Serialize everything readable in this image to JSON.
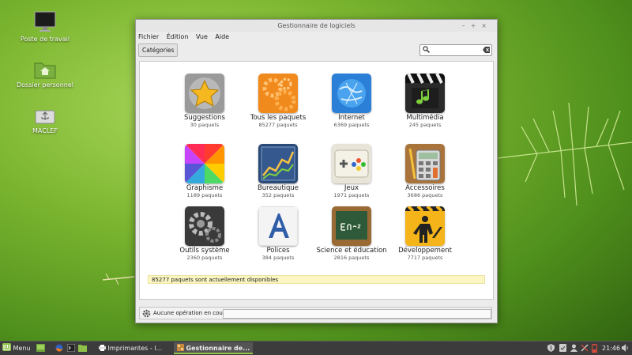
{
  "desktop": {
    "icons": [
      {
        "label": "Poste de travail",
        "icon": "computer-icon"
      },
      {
        "label": "Dossier personnel",
        "icon": "home-folder-icon"
      },
      {
        "label": "MACLEF",
        "icon": "usb-drive-icon"
      }
    ]
  },
  "window": {
    "title": "Gestionnaire de logiciels",
    "controls": [
      "–",
      "+",
      "×"
    ],
    "menu": [
      "Fichier",
      "Édition",
      "Vue",
      "Aide"
    ],
    "toolbar": {
      "categories_label": "Catégories",
      "search_value": ""
    },
    "categories": [
      {
        "name": "Suggestions",
        "count": "30 paquets",
        "icon": "star-icon"
      },
      {
        "name": "Tous les paquets",
        "count": "85277 paquets",
        "icon": "gears-icon"
      },
      {
        "name": "Internet",
        "count": "6369 paquets",
        "icon": "globe-icon"
      },
      {
        "name": "Multimédia",
        "count": "245 paquets",
        "icon": "clapperboard-icon"
      },
      {
        "name": "Graphisme",
        "count": "1189 paquets",
        "icon": "color-wheel-icon"
      },
      {
        "name": "Bureautique",
        "count": "352 paquets",
        "icon": "chart-icon"
      },
      {
        "name": "Jeux",
        "count": "1971 paquets",
        "icon": "gamepad-icon"
      },
      {
        "name": "Accessoires",
        "count": "3686 paquets",
        "icon": "calculator-icon"
      },
      {
        "name": "Outils système",
        "count": "2360 paquets",
        "icon": "system-gears-icon"
      },
      {
        "name": "Polices",
        "count": "384 paquets",
        "icon": "font-icon"
      },
      {
        "name": "Science et éducation",
        "count": "2816 paquets",
        "icon": "chalkboard-icon"
      },
      {
        "name": "Développement",
        "count": "7717 paquets",
        "icon": "construction-icon"
      }
    ],
    "notice": "85277 paquets sont actuellement disponibles",
    "status": "Aucune opération en cours"
  },
  "panel": {
    "menu_label": "Menu",
    "tasks": [
      "Imprimantes - l...",
      "Gestionnaire de..."
    ],
    "clock": "21:46"
  }
}
